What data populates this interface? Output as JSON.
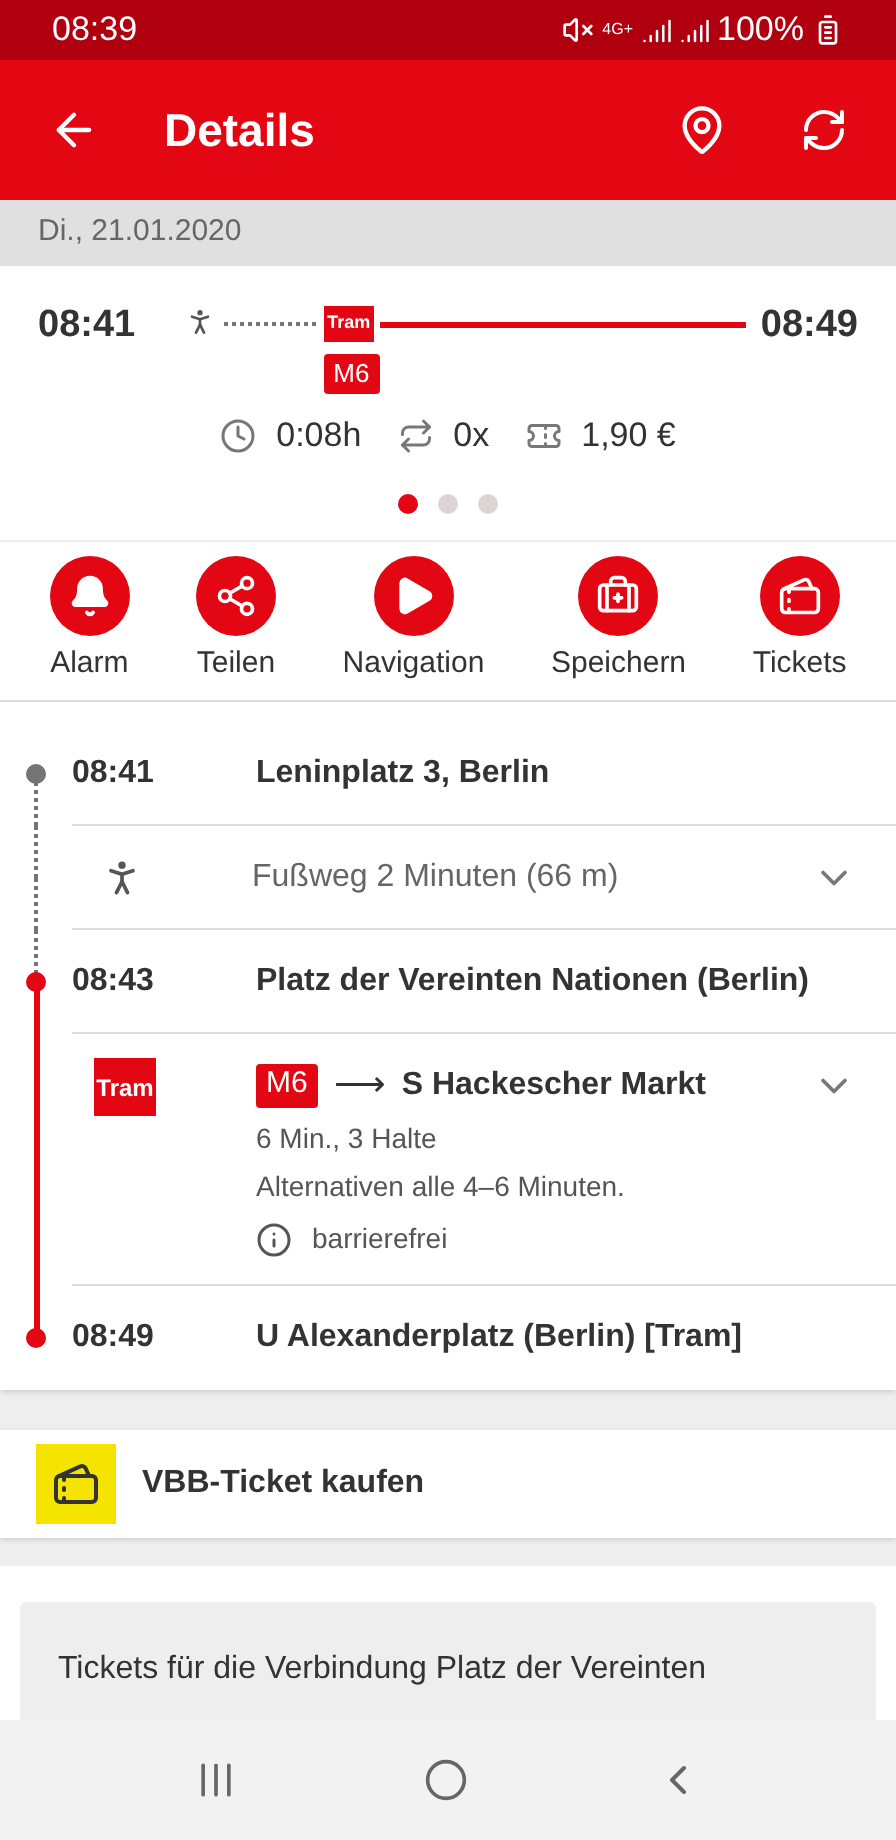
{
  "status_bar": {
    "time": "08:39",
    "network": "4G+",
    "battery": "100%"
  },
  "header": {
    "title": "Details"
  },
  "date": "Di., 21.01.2020",
  "summary": {
    "departure": "08:41",
    "arrival": "08:49",
    "mode_label": "Tram",
    "line": "M6",
    "duration": "0:08h",
    "changes": "0x",
    "price": "1,90 €",
    "pages": [
      {
        "selected": true
      },
      {
        "selected": false
      },
      {
        "selected": false
      }
    ]
  },
  "actions": [
    {
      "kind": "alarm",
      "label": "Alarm"
    },
    {
      "kind": "share",
      "label": "Teilen"
    },
    {
      "kind": "navigation",
      "label": "Navigation"
    },
    {
      "kind": "save",
      "label": "Speichern"
    },
    {
      "kind": "tickets",
      "label": "Tickets"
    }
  ],
  "timeline": [
    {
      "kind": "stop",
      "time": "08:41",
      "name": "Leninplatz 3, Berlin",
      "color": "#757575"
    },
    {
      "kind": "walk",
      "text": "Fußweg 2 Minuten (66 m)"
    },
    {
      "kind": "stop",
      "time": "08:43",
      "name": "Platz der Vereinten Nationen (Berlin)",
      "color": "#e30613"
    },
    {
      "kind": "ride",
      "mode_label": "Tram",
      "line": "M6",
      "arrow": "⟶",
      "direction": "S Hackescher Markt",
      "details": [
        "6 Min., 3 Halte",
        "Alternativen alle 4–6 Minuten."
      ],
      "accessibility": "barrierefrei"
    },
    {
      "kind": "stop",
      "time": "08:49",
      "name": "U Alexanderplatz (Berlin) [Tram]",
      "color": "#e30613"
    }
  ],
  "ticket_button": {
    "label": "VBB-Ticket kaufen"
  },
  "info_card": {
    "text": "Tickets für die Verbindung Platz der Vereinten"
  }
}
